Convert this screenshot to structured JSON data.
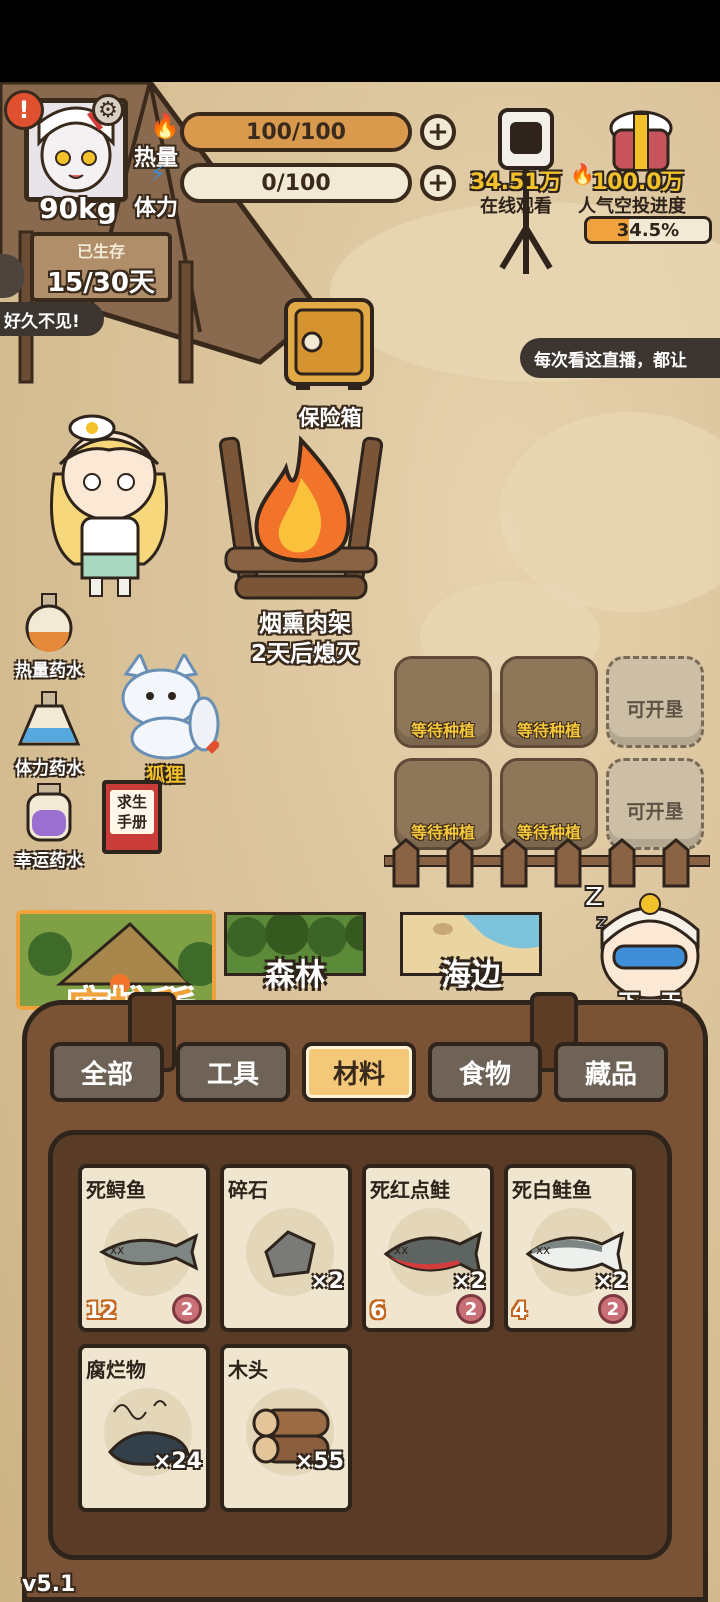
{
  "player": {
    "weight": "90kg",
    "days_label": "已生存",
    "days_value": "15/30天",
    "chat_bubble": "好久不见!"
  },
  "stats": {
    "heat_label": "热量",
    "heat_value": "100/100",
    "heat_fraction": 1.0,
    "stamina_label": "体力",
    "stamina_value": "0/100",
    "stamina_fraction": 0.0
  },
  "stream": {
    "viewers": "34.51万",
    "viewers_label": "在线观看",
    "popularity": "100.0万",
    "popularity_label": "人气空投进度",
    "airdrop_progress": "34.5%",
    "airdrop_fraction": 0.345,
    "marquee": "每次看这直播，都让"
  },
  "scene": {
    "safe_label": "保险箱",
    "campfire_name": "烟熏肉架",
    "campfire_status": "2天后熄灭",
    "pet_name": "狐狸",
    "manual_label": "求生手册",
    "next_day_label": "下一天"
  },
  "potions": [
    {
      "label": "热量药水",
      "color": "#e48a3a"
    },
    {
      "label": "体力药水",
      "color": "#58a8e0"
    },
    {
      "label": "幸运药水",
      "color": "#9a6fd0"
    }
  ],
  "plots": [
    {
      "label": "等待种植",
      "locked": false
    },
    {
      "label": "等待种植",
      "locked": false
    },
    {
      "label": "可开垦",
      "locked": true
    },
    {
      "label": "等待种植",
      "locked": false
    },
    {
      "label": "等待种植",
      "locked": false
    },
    {
      "label": "可开垦",
      "locked": true
    }
  ],
  "locations": {
    "shelter": "庇护所",
    "forest": "森林",
    "beach": "海边"
  },
  "tabs": [
    "全部",
    "工具",
    "材料",
    "食物",
    "藏品"
  ],
  "active_tab": "材料",
  "items": [
    {
      "name": "死鲟鱼",
      "qty": "",
      "calories": "12",
      "badge": "2",
      "icon": "dead-sturgeon-icon"
    },
    {
      "name": "碎石",
      "qty": "×2",
      "calories": "",
      "badge": "",
      "icon": "gravel-icon"
    },
    {
      "name": "死红点鲑",
      "qty": "×2",
      "calories": "6",
      "badge": "2",
      "icon": "dead-red-trout-icon"
    },
    {
      "name": "死白鲑鱼",
      "qty": "×2",
      "calories": "4",
      "badge": "2",
      "icon": "dead-whitefish-icon"
    },
    {
      "name": "腐烂物",
      "qty": "×24",
      "calories": "",
      "badge": "",
      "icon": "rotten-matter-icon"
    },
    {
      "name": "木头",
      "qty": "×55",
      "calories": "",
      "badge": "",
      "icon": "wood-log-icon"
    }
  ],
  "version": "v5.1"
}
